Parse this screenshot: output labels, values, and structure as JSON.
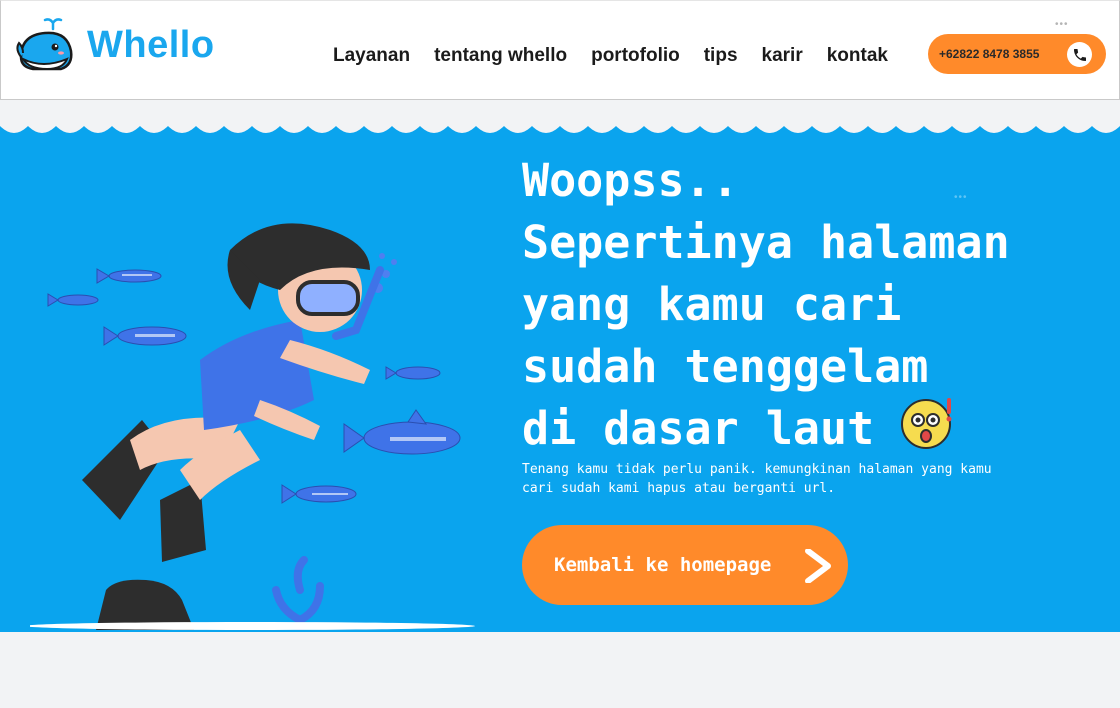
{
  "brand": {
    "name": "Whello"
  },
  "nav": {
    "items": [
      {
        "label": "Layanan"
      },
      {
        "label": "tentang whello"
      },
      {
        "label": "portofolio"
      },
      {
        "label": "tips"
      },
      {
        "label": "karir"
      },
      {
        "label": "kontak"
      }
    ]
  },
  "contact": {
    "phone": "+62822 8478 3855"
  },
  "hero": {
    "line1": "Woopss..",
    "line2": "Sepertinya halaman",
    "line3": "yang kamu cari",
    "line4": "sudah tenggelam",
    "line5": "di dasar laut",
    "subtitle": "Tenang kamu tidak perlu panik. kemungkinan halaman yang kamu cari sudah kami hapus atau berganti url.",
    "button_label": "Kembali ke homepage"
  },
  "icons": {
    "logo": "whale-logo-icon",
    "phone": "phone-icon",
    "emoji": "shocked-face-icon",
    "button": "chevron-right-icon"
  },
  "colors": {
    "brand_blue": "#1aa7ee",
    "hero_bg": "#0aa4ee",
    "accent_orange": "#ff8a2a",
    "nav_text": "#1b1b1b"
  }
}
